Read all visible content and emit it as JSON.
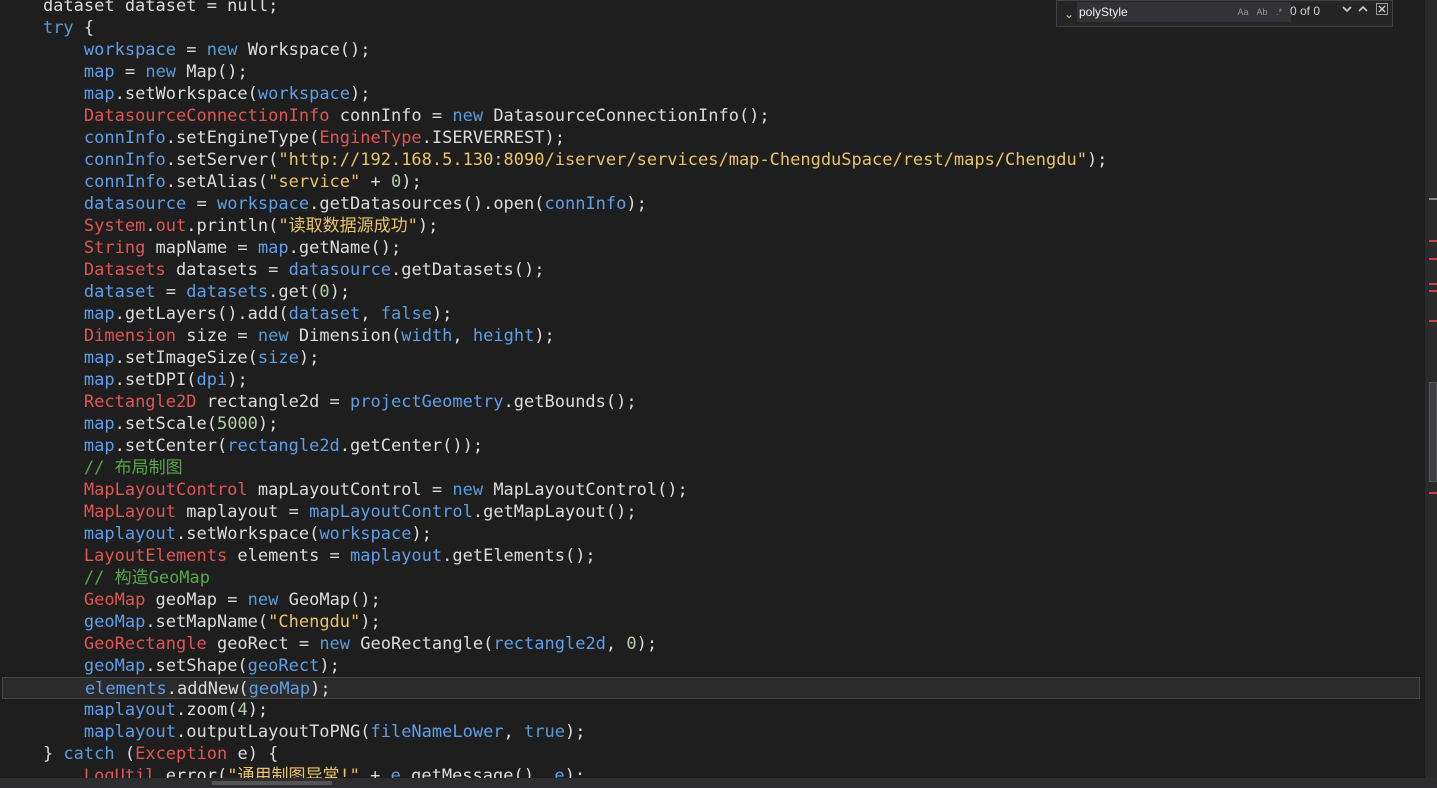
{
  "editor": {
    "lines": [
      {
        "current": false,
        "tokens": [
          [
            "    dataset dataset = null;",
            "plain"
          ]
        ]
      },
      {
        "current": false,
        "tokens": [
          [
            "    ",
            "plain"
          ],
          [
            "try",
            "kw"
          ],
          [
            " {",
            "punc"
          ]
        ]
      },
      {
        "current": false,
        "tokens": [
          [
            "        ",
            "plain"
          ],
          [
            "workspace",
            "var"
          ],
          [
            " = ",
            "punc"
          ],
          [
            "new",
            "kw"
          ],
          [
            " Workspace();",
            "plain"
          ]
        ]
      },
      {
        "current": false,
        "tokens": [
          [
            "        ",
            "plain"
          ],
          [
            "map",
            "var"
          ],
          [
            " = ",
            "punc"
          ],
          [
            "new",
            "kw"
          ],
          [
            " Map();",
            "plain"
          ]
        ]
      },
      {
        "current": false,
        "tokens": [
          [
            "        ",
            "plain"
          ],
          [
            "map",
            "var"
          ],
          [
            ".setWorkspace(",
            "plain"
          ],
          [
            "workspace",
            "var"
          ],
          [
            ");",
            "punc"
          ]
        ]
      },
      {
        "current": false,
        "tokens": [
          [
            "        ",
            "plain"
          ],
          [
            "DatasourceConnectionInfo",
            "cls"
          ],
          [
            " connInfo = ",
            "plain"
          ],
          [
            "new",
            "kw"
          ],
          [
            " DatasourceConnectionInfo();",
            "plain"
          ]
        ]
      },
      {
        "current": false,
        "tokens": [
          [
            "        ",
            "plain"
          ],
          [
            "connInfo",
            "var"
          ],
          [
            ".setEngineType(",
            "plain"
          ],
          [
            "EngineType",
            "cls"
          ],
          [
            ".ISERVERREST);",
            "plain"
          ]
        ]
      },
      {
        "current": false,
        "tokens": [
          [
            "        ",
            "plain"
          ],
          [
            "connInfo",
            "var"
          ],
          [
            ".setServer(",
            "plain"
          ],
          [
            "\"http://192.168.5.130:8090/iserver/services/map-ChengduSpace/rest/maps/Chengdu\"",
            "str"
          ],
          [
            ");",
            "punc"
          ]
        ]
      },
      {
        "current": false,
        "tokens": [
          [
            "        ",
            "plain"
          ],
          [
            "connInfo",
            "var"
          ],
          [
            ".setAlias(",
            "plain"
          ],
          [
            "\"service\"",
            "str"
          ],
          [
            " + ",
            "punc"
          ],
          [
            "0",
            "num"
          ],
          [
            ");",
            "punc"
          ]
        ]
      },
      {
        "current": false,
        "tokens": [
          [
            "        ",
            "plain"
          ],
          [
            "datasource",
            "var"
          ],
          [
            " = ",
            "punc"
          ],
          [
            "workspace",
            "var"
          ],
          [
            ".getDatasources().open(",
            "plain"
          ],
          [
            "connInfo",
            "var"
          ],
          [
            ");",
            "punc"
          ]
        ]
      },
      {
        "current": false,
        "tokens": [
          [
            "        ",
            "plain"
          ],
          [
            "System",
            "cls"
          ],
          [
            ".",
            "punc"
          ],
          [
            "out",
            "field"
          ],
          [
            ".println(",
            "plain"
          ],
          [
            "\"读取数据源成功\"",
            "str"
          ],
          [
            ");",
            "punc"
          ]
        ]
      },
      {
        "current": false,
        "tokens": [
          [
            "        ",
            "plain"
          ],
          [
            "String",
            "cls"
          ],
          [
            " mapName = ",
            "plain"
          ],
          [
            "map",
            "var"
          ],
          [
            ".getName();",
            "plain"
          ]
        ]
      },
      {
        "current": false,
        "tokens": [
          [
            "        ",
            "plain"
          ],
          [
            "Datasets",
            "cls"
          ],
          [
            " datasets = ",
            "plain"
          ],
          [
            "datasource",
            "var"
          ],
          [
            ".getDatasets();",
            "plain"
          ]
        ]
      },
      {
        "current": false,
        "tokens": [
          [
            "        ",
            "plain"
          ],
          [
            "dataset",
            "var"
          ],
          [
            " = ",
            "punc"
          ],
          [
            "datasets",
            "var"
          ],
          [
            ".get(",
            "plain"
          ],
          [
            "0",
            "num"
          ],
          [
            ");",
            "punc"
          ]
        ]
      },
      {
        "current": false,
        "tokens": [
          [
            "        ",
            "plain"
          ],
          [
            "map",
            "var"
          ],
          [
            ".getLayers().add(",
            "plain"
          ],
          [
            "dataset",
            "var"
          ],
          [
            ", ",
            "punc"
          ],
          [
            "false",
            "kw"
          ],
          [
            ");",
            "punc"
          ]
        ]
      },
      {
        "current": false,
        "tokens": [
          [
            "        ",
            "plain"
          ],
          [
            "Dimension",
            "cls"
          ],
          [
            " size = ",
            "plain"
          ],
          [
            "new",
            "kw"
          ],
          [
            " Dimension(",
            "plain"
          ],
          [
            "width",
            "var"
          ],
          [
            ", ",
            "punc"
          ],
          [
            "height",
            "var"
          ],
          [
            ");",
            "punc"
          ]
        ]
      },
      {
        "current": false,
        "tokens": [
          [
            "        ",
            "plain"
          ],
          [
            "map",
            "var"
          ],
          [
            ".setImageSize(",
            "plain"
          ],
          [
            "size",
            "var"
          ],
          [
            ");",
            "punc"
          ]
        ]
      },
      {
        "current": false,
        "tokens": [
          [
            "        ",
            "plain"
          ],
          [
            "map",
            "var"
          ],
          [
            ".setDPI(",
            "plain"
          ],
          [
            "dpi",
            "var"
          ],
          [
            ");",
            "punc"
          ]
        ]
      },
      {
        "current": false,
        "tokens": [
          [
            "        ",
            "plain"
          ],
          [
            "Rectangle2D",
            "cls"
          ],
          [
            " rectangle2d = ",
            "plain"
          ],
          [
            "projectGeometry",
            "var"
          ],
          [
            ".getBounds();",
            "plain"
          ]
        ]
      },
      {
        "current": false,
        "tokens": [
          [
            "        ",
            "plain"
          ],
          [
            "map",
            "var"
          ],
          [
            ".setScale(",
            "plain"
          ],
          [
            "5000",
            "num"
          ],
          [
            ");",
            "punc"
          ]
        ]
      },
      {
        "current": false,
        "tokens": [
          [
            "        ",
            "plain"
          ],
          [
            "map",
            "var"
          ],
          [
            ".setCenter(",
            "plain"
          ],
          [
            "rectangle2d",
            "var"
          ],
          [
            ".getCenter());",
            "plain"
          ]
        ]
      },
      {
        "current": false,
        "tokens": [
          [
            "        ",
            "plain"
          ],
          [
            "// 布局制图",
            "com"
          ]
        ]
      },
      {
        "current": false,
        "tokens": [
          [
            "        ",
            "plain"
          ],
          [
            "MapLayoutControl",
            "cls"
          ],
          [
            " mapLayoutControl = ",
            "plain"
          ],
          [
            "new",
            "kw"
          ],
          [
            " MapLayoutControl();",
            "plain"
          ]
        ]
      },
      {
        "current": false,
        "tokens": [
          [
            "        ",
            "plain"
          ],
          [
            "MapLayout",
            "cls"
          ],
          [
            " maplayout = ",
            "plain"
          ],
          [
            "mapLayoutControl",
            "var"
          ],
          [
            ".getMapLayout();",
            "plain"
          ]
        ]
      },
      {
        "current": false,
        "tokens": [
          [
            "        ",
            "plain"
          ],
          [
            "maplayout",
            "var"
          ],
          [
            ".setWorkspace(",
            "plain"
          ],
          [
            "workspace",
            "var"
          ],
          [
            ");",
            "punc"
          ]
        ]
      },
      {
        "current": false,
        "tokens": [
          [
            "        ",
            "plain"
          ],
          [
            "LayoutElements",
            "cls"
          ],
          [
            " elements = ",
            "plain"
          ],
          [
            "maplayout",
            "var"
          ],
          [
            ".getElements();",
            "plain"
          ]
        ]
      },
      {
        "current": false,
        "tokens": [
          [
            "        ",
            "plain"
          ],
          [
            "// 构造GeoMap",
            "com"
          ]
        ]
      },
      {
        "current": false,
        "tokens": [
          [
            "        ",
            "plain"
          ],
          [
            "GeoMap",
            "cls"
          ],
          [
            " geoMap = ",
            "plain"
          ],
          [
            "new",
            "kw"
          ],
          [
            " GeoMap();",
            "plain"
          ]
        ]
      },
      {
        "current": false,
        "tokens": [
          [
            "        ",
            "plain"
          ],
          [
            "geoMap",
            "var"
          ],
          [
            ".setMapName(",
            "plain"
          ],
          [
            "\"Chengdu\"",
            "str"
          ],
          [
            ");",
            "punc"
          ]
        ]
      },
      {
        "current": false,
        "tokens": [
          [
            "        ",
            "plain"
          ],
          [
            "GeoRectangle",
            "cls"
          ],
          [
            " geoRect = ",
            "plain"
          ],
          [
            "new",
            "kw"
          ],
          [
            " GeoRectangle(",
            "plain"
          ],
          [
            "rectangle2d",
            "var"
          ],
          [
            ", ",
            "punc"
          ],
          [
            "0",
            "num"
          ],
          [
            ");",
            "punc"
          ]
        ]
      },
      {
        "current": false,
        "tokens": [
          [
            "        ",
            "plain"
          ],
          [
            "geoMap",
            "var"
          ],
          [
            ".setShape(",
            "plain"
          ],
          [
            "geoRect",
            "var"
          ],
          [
            ");",
            "punc"
          ]
        ]
      },
      {
        "current": true,
        "tokens": [
          [
            "        ",
            "plain"
          ],
          [
            "elements",
            "var"
          ],
          [
            ".addNew(",
            "plain"
          ],
          [
            "geoMap",
            "var"
          ],
          [
            ");",
            "punc"
          ]
        ]
      },
      {
        "current": false,
        "tokens": [
          [
            "        ",
            "plain"
          ],
          [
            "maplayout",
            "var"
          ],
          [
            ".zoom(",
            "plain"
          ],
          [
            "4",
            "num"
          ],
          [
            ");",
            "punc"
          ]
        ]
      },
      {
        "current": false,
        "tokens": [
          [
            "        ",
            "plain"
          ],
          [
            "maplayout",
            "var"
          ],
          [
            ".outputLayoutToPNG(",
            "plain"
          ],
          [
            "fileNameLower",
            "var"
          ],
          [
            ", ",
            "punc"
          ],
          [
            "true",
            "kw"
          ],
          [
            ");",
            "punc"
          ]
        ]
      },
      {
        "current": false,
        "tokens": [
          [
            "    } ",
            "plain"
          ],
          [
            "catch",
            "kw"
          ],
          [
            " (",
            "punc"
          ],
          [
            "Exception",
            "cls"
          ],
          [
            " e) {",
            "plain"
          ]
        ]
      },
      {
        "current": false,
        "tokens": [
          [
            "        ",
            "plain"
          ],
          [
            "LogUtil",
            "cls"
          ],
          [
            ".error(",
            "plain"
          ],
          [
            "\"通用制图异常!\"",
            "str"
          ],
          [
            " + ",
            "punc"
          ],
          [
            "e",
            "var"
          ],
          [
            ".getMessage(), ",
            "plain"
          ],
          [
            "e",
            "var"
          ],
          [
            ");",
            "punc"
          ]
        ]
      }
    ]
  },
  "find": {
    "query": "polyStyle",
    "placeholder": "",
    "count": "0 of 0",
    "match_case_label": "Aa",
    "whole_word_label": "Ab",
    "regex_label": ".*",
    "toggle_icon": "chevron-down-icon",
    "prev_icon": "chevron-down-icon",
    "next_icon": "chevron-up-icon",
    "close_icon": "close-icon"
  },
  "colors": {
    "background": "#1e1e1e",
    "keyword": "#569cd6",
    "type": "#e05555",
    "string": "#e8c468",
    "number": "#b5cea8",
    "variable": "#5f9ee8",
    "comment": "#57a64a"
  }
}
